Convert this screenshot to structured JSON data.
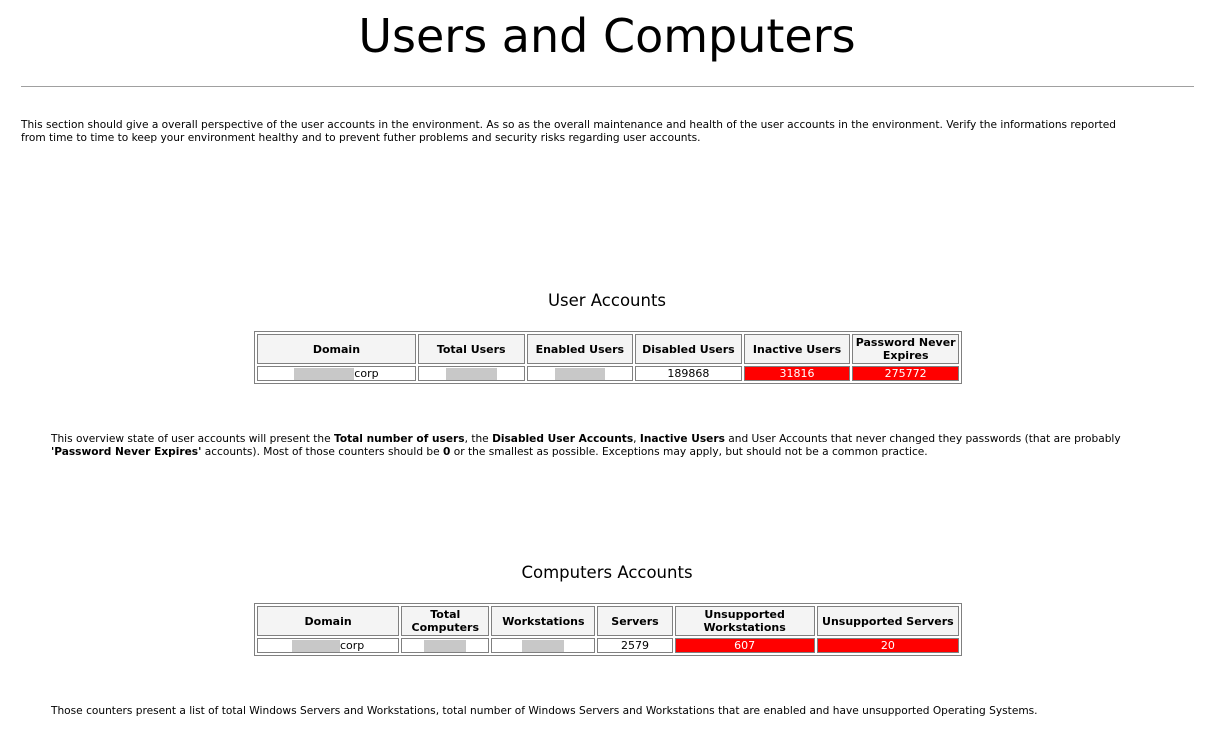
{
  "page": {
    "title": "Users and Computers",
    "intro": "This section should give a overall perspective of the user accounts in the environment. As so as the overall maintenance and health of the user accounts in the environment. Verify the informations reported from time to time to keep your environment healthy and to prevent futher problems and security risks regarding user accounts."
  },
  "user_accounts": {
    "title": "User Accounts",
    "headers": [
      "Domain",
      "Total Users",
      "Enabled Users",
      "Disabled Users",
      "Inactive Users",
      "Password Never Expires"
    ],
    "row": {
      "domain_suffix": "corp",
      "disabled_users": "189868",
      "inactive_users": "31816",
      "password_never_expires": "275772"
    },
    "note": {
      "p1": "This overview state of user accounts will present the ",
      "b1": "Total number of users",
      "p2": ", the ",
      "b2": "Disabled User Accounts",
      "p3": ", ",
      "b3": "Inactive Users",
      "p4": " and User Accounts that never changed they passwords (that are probably ",
      "b4": "'Password Never Expires'",
      "p5": " accounts). Most of those counters should be ",
      "b5": "0",
      "p6": " or the smallest as possible. Exceptions may apply, but should not be a common practice."
    }
  },
  "computer_accounts": {
    "title": "Computers Accounts",
    "headers": [
      "Domain",
      "Total Computers",
      "Workstations",
      "Servers",
      "Unsupported Workstations",
      "Unsupported Servers"
    ],
    "row": {
      "domain_suffix": "corp",
      "servers": "2579",
      "unsupported_workstations": "607",
      "unsupported_servers": "20"
    },
    "note": "Those counters present a list of total Windows Servers and Workstations, total number of Windows Servers and Workstations that are enabled and have unsupported Operating Systems."
  },
  "colors": {
    "alert": "#ff0000",
    "header_bg": "#f4f4f4",
    "redacted": "#c8c8c8"
  }
}
